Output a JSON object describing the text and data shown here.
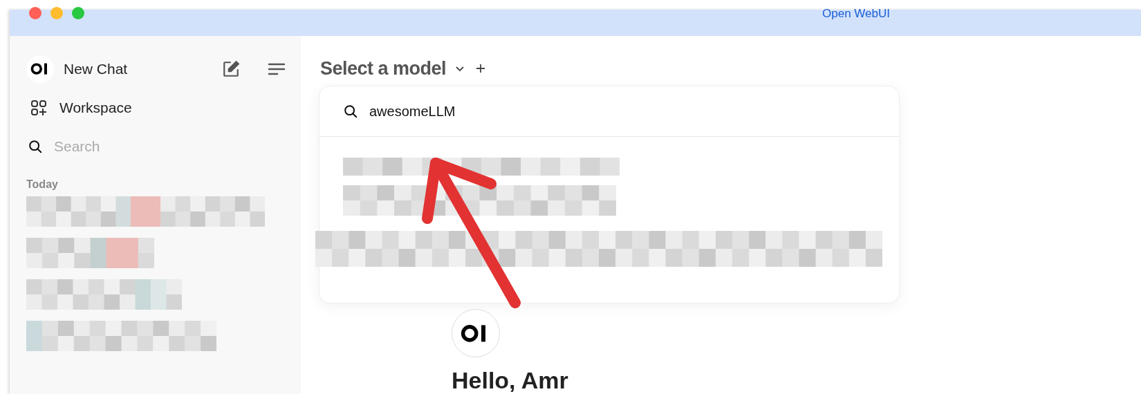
{
  "window": {
    "title": "Open WebUI"
  },
  "sidebar": {
    "new_chat": "New Chat",
    "items": [
      {
        "kind": "workspace",
        "label": "Workspace"
      }
    ],
    "search": {
      "placeholder": "Search"
    },
    "section": "Today"
  },
  "main": {
    "model_selector": "Select a model",
    "model_search": {
      "value": "awesomeLLM"
    },
    "greeting": "Hello, Amr"
  }
}
